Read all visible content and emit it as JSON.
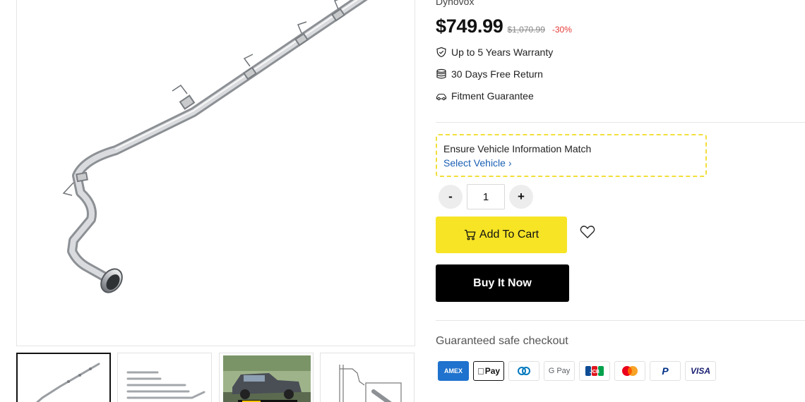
{
  "brand": "Dynovox",
  "price": {
    "current": "$749.99",
    "compare_at": "$1,070.99",
    "discount": "-30%"
  },
  "perks": [
    {
      "icon": "shield-check-icon",
      "label": "Up to 5 Years Warranty"
    },
    {
      "icon": "database-icon",
      "label": "30 Days Free Return"
    },
    {
      "icon": "car-icon",
      "label": "Fitment Guarantee"
    }
  ],
  "vehicle": {
    "title": "Ensure Vehicle Information Match",
    "link": "Select Vehicle ›"
  },
  "quantity": {
    "minus": "-",
    "value": "1",
    "plus": "+"
  },
  "buttons": {
    "add_to_cart": "Add To Cart",
    "buy_now": "Buy It Now"
  },
  "checkout": {
    "title": "Guaranteed safe checkout",
    "methods": [
      {
        "name": "amex",
        "label": "AMEX"
      },
      {
        "name": "apple-pay",
        "label": "Pay"
      },
      {
        "name": "diners",
        "label": ""
      },
      {
        "name": "google-pay",
        "label": "G Pay"
      },
      {
        "name": "jcb",
        "label": "JCB"
      },
      {
        "name": "mastercard",
        "label": ""
      },
      {
        "name": "paypal",
        "label": "P"
      },
      {
        "name": "visa",
        "label": "VISA"
      }
    ]
  },
  "colors": {
    "accent_yellow": "#f6e425",
    "price_red": "#e53935",
    "link_blue": "#1a5fb4",
    "buy_black": "#000000"
  }
}
